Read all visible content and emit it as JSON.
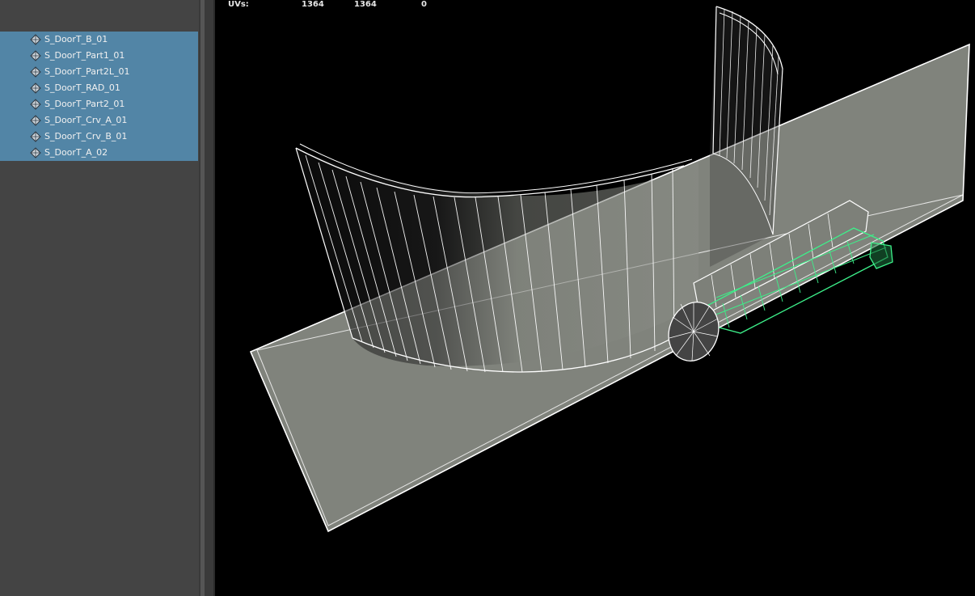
{
  "outliner": {
    "items": [
      {
        "label": "S_DoorT_B_01",
        "icon": "mesh-icon"
      },
      {
        "label": "S_DoorT_Part1_01",
        "icon": "mesh-icon"
      },
      {
        "label": "S_DoorT_Part2L_01",
        "icon": "mesh-icon"
      },
      {
        "label": "S_DoorT_RAD_01",
        "icon": "mesh-icon"
      },
      {
        "label": "S_DoorT_Part2_01",
        "icon": "mesh-icon"
      },
      {
        "label": "S_DoorT_Crv_A_01",
        "icon": "mesh-icon"
      },
      {
        "label": "S_DoorT_Crv_B_01",
        "icon": "mesh-icon"
      },
      {
        "label": "S_DoorT_A_02",
        "icon": "mesh-icon"
      }
    ],
    "selection_color": "#5285a6"
  },
  "viewport": {
    "hud": {
      "label": "UVs:",
      "values": [
        "1364",
        "1364",
        "0"
      ]
    },
    "colors": {
      "background": "#000000",
      "wireframe": "#ffffff",
      "selected_wireframe": "#3df08a",
      "shaded_surface": "#80837c"
    }
  }
}
